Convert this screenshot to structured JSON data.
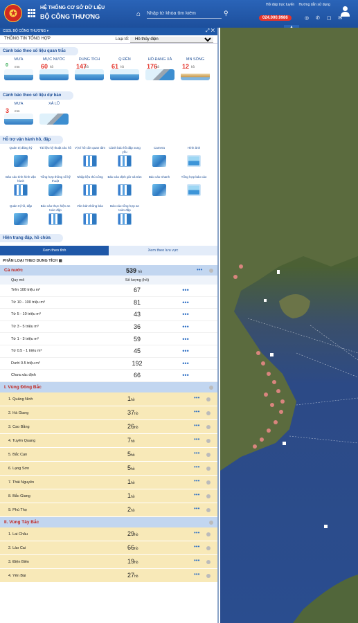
{
  "header": {
    "title_line1": "HỆ THỐNG CƠ SỞ DỮ LIỆU",
    "title_line2": "BỘ CÔNG THƯƠNG",
    "search_placeholder": "Nhập từ khóa tìm kiếm",
    "top_link_1": "Hỏi đáp trực tuyến",
    "top_link_2": "Hướng dẫn sử dụng",
    "hotline": "024.000.9986",
    "social": "◎ ✆ ▢ ✉"
  },
  "panel": {
    "bar_title": "CSDL BỘ CÔNG THƯƠNG",
    "tab_label": "THÔNG TIN TỔNG HỢP",
    "layer_label": "Loại tổ:",
    "layer_value": "Hồ thủy điện"
  },
  "sections": {
    "monitoring": "Cảnh báo theo số liệu quan trắc",
    "forecast": "Cảnh báo theo số liệu dự báo",
    "support": "Hỗ trợ vận hành hồ, đập",
    "status": "Hiện trạng đập, hồ chứa"
  },
  "monitoring_cards": [
    {
      "label": "MƯA",
      "value": "0",
      "unit": "mm",
      "img": "rain",
      "green": true
    },
    {
      "label": "MỰC NƯỚC",
      "value": "60",
      "unit": "hồ",
      "img": "water"
    },
    {
      "label": "DUNG TÍCH",
      "value": "147",
      "unit": "hồ",
      "img": "water"
    },
    {
      "label": "Q ĐẾN",
      "value": "61",
      "unit": "hồ",
      "img": "water"
    },
    {
      "label": "HỒ ĐANG XẢ",
      "value": "176",
      "unit": "hồ",
      "img": "dam"
    },
    {
      "label": "MN SÔNG",
      "value": "12",
      "unit": "hồ",
      "img": "stone"
    }
  ],
  "forecast_cards": [
    {
      "label": "MƯA",
      "value": "3",
      "unit": "mm",
      "img": "rain"
    },
    {
      "label": "XẢ LŨ",
      "value": "",
      "unit": "",
      "img": "dam"
    }
  ],
  "tools": [
    {
      "label": "Quản trị đăng ký",
      "icon": "photo"
    },
    {
      "label": "Tài liệu kỹ thuật các hồ",
      "icon": "photo"
    },
    {
      "label": "Vị trí hồ cần quan tâm",
      "icon": "chart"
    },
    {
      "label": "Cảnh báo hồ đập xung yếu",
      "icon": "chart"
    },
    {
      "label": "Camera",
      "icon": "photo"
    },
    {
      "label": "Hình ảnh",
      "icon": "pic"
    },
    {
      "label": "Báo cáo tình hình vận hành",
      "icon": "chart"
    },
    {
      "label": "Tổng hợp thông số kỹ thuật",
      "icon": "photo"
    },
    {
      "label": "Nhập liệu thủ công",
      "icon": "chart"
    },
    {
      "label": "Báo cáo định giờ xả tràn",
      "icon": "chart"
    },
    {
      "label": "Báo cáo nhanh",
      "icon": "photo"
    },
    {
      "label": "Tổng hợp báo cáo",
      "icon": "pic"
    },
    {
      "label": "Quản trị hồ, đập",
      "icon": "photo"
    },
    {
      "label": "Báo cáo thực hiện an toàn đập",
      "icon": "chart"
    },
    {
      "label": "Văn bản thông báo",
      "icon": "chart"
    },
    {
      "label": "Báo cáo tổng hợp an toàn đập",
      "icon": "chart"
    }
  ],
  "subtabs": {
    "province": "Xem theo tỉnh",
    "basin": "Xem theo lưu vực"
  },
  "classify_label": "PHÂN LOẠI THEO DUNG TÍCH",
  "nation": {
    "label": "Cả nước",
    "count": "539",
    "unit": "hồ"
  },
  "table": {
    "head_scale": "Quy mô",
    "head_count": "Số lượng (hồ)",
    "rows": [
      {
        "scale": "Trên 100 triệu m³",
        "count": "67"
      },
      {
        "scale": "Từ 10 - 100 triệu m³",
        "count": "81"
      },
      {
        "scale": "Từ 5 - 10 triệu m³",
        "count": "43"
      },
      {
        "scale": "Từ 3 - 5 triệu m³",
        "count": "36"
      },
      {
        "scale": "Từ 1 - 3 triệu m³",
        "count": "59"
      },
      {
        "scale": "Từ 0.5 - 1 triệu m³",
        "count": "45"
      },
      {
        "scale": "Dưới 0.5 triệu m³",
        "count": "192"
      },
      {
        "scale": "Chưa xác định",
        "count": "66"
      }
    ]
  },
  "region1": {
    "label": "I. Vùng Đông Bắc",
    "provinces": [
      {
        "name": "1. Quảng Ninh",
        "count": "1",
        "unit": "hồ"
      },
      {
        "name": "2. Hà Giang",
        "count": "37",
        "unit": "hồ"
      },
      {
        "name": "3. Cao Bằng",
        "count": "26",
        "unit": "hồ"
      },
      {
        "name": "4. Tuyên Quang",
        "count": "7",
        "unit": "hồ"
      },
      {
        "name": "5. Bắc Cạn",
        "count": "5",
        "unit": "hồ"
      },
      {
        "name": "6. Lạng Sơn",
        "count": "5",
        "unit": "hồ"
      },
      {
        "name": "7. Thái Nguyên",
        "count": "1",
        "unit": "hồ"
      },
      {
        "name": "8. Bắc Giang",
        "count": "1",
        "unit": "hồ"
      },
      {
        "name": "9. Phú Thọ",
        "count": "2",
        "unit": "hồ"
      }
    ]
  },
  "region2": {
    "label": "II. Vùng Tây Bắc",
    "provinces": [
      {
        "name": "1. Lai Châu",
        "count": "29",
        "unit": "hồ"
      },
      {
        "name": "2. Lào Cai",
        "count": "66",
        "unit": "hồ"
      },
      {
        "name": "3. Điện Biên",
        "count": "19",
        "unit": "hồ"
      },
      {
        "name": "4. Yên Bái",
        "count": "27",
        "unit": "hồ"
      }
    ]
  },
  "colors": {
    "brand": "#1f58a8",
    "alert": "#e4342b",
    "province_row": "#f8e9b8"
  }
}
